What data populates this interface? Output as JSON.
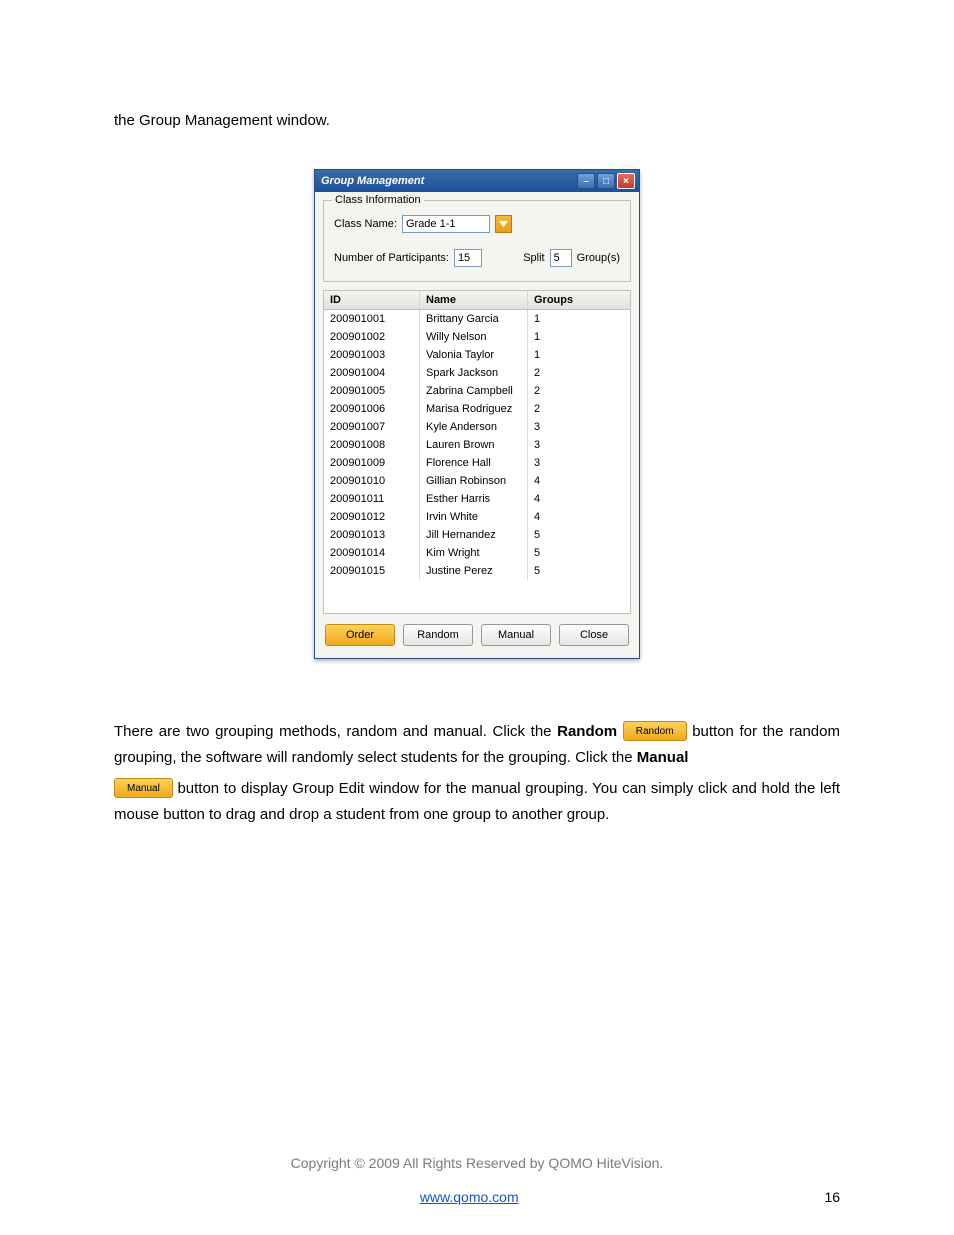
{
  "intro_text": "the Group Management window.",
  "window": {
    "title": "Group Management",
    "fieldset_legend": "Class Information",
    "class_name_label": "Class Name:",
    "class_name_value": "Grade 1-1",
    "num_participants_label": "Number of Participants:",
    "num_participants_value": "15",
    "split_label": "Split",
    "split_value": "5",
    "groups_suffix": "Group(s)",
    "columns": {
      "id": "ID",
      "name": "Name",
      "groups": "Groups"
    },
    "rows": [
      {
        "id": "200901001",
        "name": "Brittany Garcia",
        "group": "1"
      },
      {
        "id": "200901002",
        "name": "Willy Nelson",
        "group": "1"
      },
      {
        "id": "200901003",
        "name": "Valonia Taylor",
        "group": "1"
      },
      {
        "id": "200901004",
        "name": "Spark Jackson",
        "group": "2"
      },
      {
        "id": "200901005",
        "name": "Zabrina Campbell",
        "group": "2"
      },
      {
        "id": "200901006",
        "name": "Marisa Rodriguez",
        "group": "2"
      },
      {
        "id": "200901007",
        "name": "Kyle Anderson",
        "group": "3"
      },
      {
        "id": "200901008",
        "name": "Lauren Brown",
        "group": "3"
      },
      {
        "id": "200901009",
        "name": "Florence Hall",
        "group": "3"
      },
      {
        "id": "200901010",
        "name": "Gillian Robinson",
        "group": "4"
      },
      {
        "id": "200901011",
        "name": "Esther Harris",
        "group": "4"
      },
      {
        "id": "200901012",
        "name": "Irvin White",
        "group": "4"
      },
      {
        "id": "200901013",
        "name": "Jill  Hernandez",
        "group": "5"
      },
      {
        "id": "200901014",
        "name": "Kim Wright",
        "group": "5"
      },
      {
        "id": "200901015",
        "name": "Justine Perez",
        "group": "5"
      }
    ],
    "buttons": {
      "order": "Order",
      "random": "Random",
      "manual": "Manual",
      "close": "Close"
    }
  },
  "para1_a": "There are two grouping methods, random and manual. Click the ",
  "para1_bold1": "Random",
  "inline_random": "Random",
  "para1_b": "button for the random grouping, the software will randomly select students for the grouping. Click the ",
  "para1_bold2": "Manual",
  "inline_manual": "Manual",
  "para2": " button to display Group Edit window for the manual grouping. You can simply click and hold the left mouse button to drag and drop a student from one group to another group.",
  "copyright": "Copyright © 2009 All Rights Reserved by QOMO HiteVision.",
  "url": "www.qomo.com",
  "page_number": "16"
}
